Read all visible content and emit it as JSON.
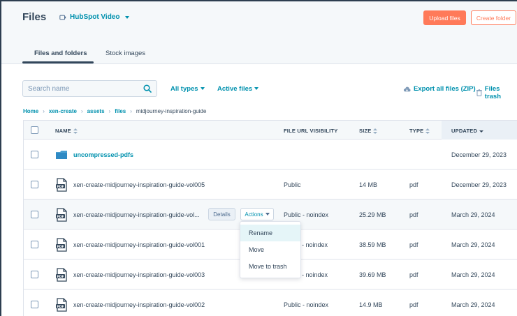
{
  "header": {
    "title": "Files",
    "video_label": "HubSpot Video",
    "upload_label": "Upload files",
    "create_folder_label": "Create folder"
  },
  "tabs": [
    {
      "label": "Files and folders",
      "active": true
    },
    {
      "label": "Stock images",
      "active": false
    }
  ],
  "toolbar": {
    "search_placeholder": "Search name",
    "type_filter": "All types",
    "status_filter": "Active files",
    "export_label": "Export all files (ZIP)",
    "trash_label": "Files trash"
  },
  "breadcrumb": [
    "Home",
    "xen-create",
    "assets",
    "files",
    "midjourney-inspiration-guide"
  ],
  "table": {
    "columns": [
      "NAME",
      "FILE URL VISIBILITY",
      "SIZE",
      "TYPE",
      "UPDATED"
    ],
    "rows": [
      {
        "name": "uncompressed-pdfs",
        "kind": "folder",
        "visibility": "",
        "size": "",
        "type": "",
        "updated": "December 29, 2023"
      },
      {
        "name": "xen-create-midjourney-inspiration-guide-vol005",
        "kind": "pdf",
        "visibility": "Public",
        "size": "14 MB",
        "type": "pdf",
        "updated": "December 29, 2023"
      },
      {
        "name": "xen-create-midjourney-inspiration-guide-vol...",
        "kind": "pdf",
        "visibility": "Public - noindex",
        "size": "25.29 MB",
        "type": "pdf",
        "updated": "March 29, 2024"
      },
      {
        "name": "xen-create-midjourney-inspiration-guide-vol001",
        "kind": "pdf",
        "visibility": "- noindex",
        "size": "38.59 MB",
        "type": "pdf",
        "updated": "March 29, 2024"
      },
      {
        "name": "xen-create-midjourney-inspiration-guide-vol003",
        "kind": "pdf",
        "visibility": "- noindex",
        "size": "39.69 MB",
        "type": "pdf",
        "updated": "March 29, 2024"
      },
      {
        "name": "xen-create-midjourney-inspiration-guide-vol002",
        "kind": "pdf",
        "visibility": "Public - noindex",
        "size": "14.9 MB",
        "type": "pdf",
        "updated": "March 29, 2024"
      }
    ],
    "row_actions": {
      "details": "Details",
      "actions": "Actions"
    }
  },
  "actions_menu": [
    "Rename",
    "Move",
    "Move to trash"
  ],
  "colors": {
    "accent": "#0091ae",
    "primary": "#ff7a59",
    "text": "#33475b"
  }
}
